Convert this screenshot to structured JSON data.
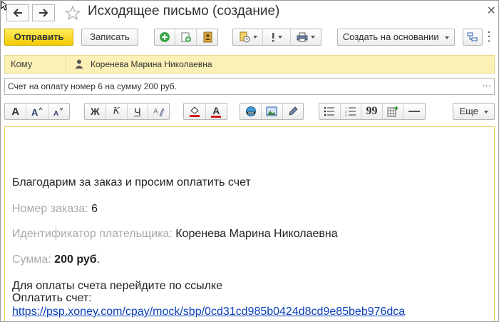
{
  "window": {
    "title": "Исходящее письмо (создание)",
    "close_glyph": "×",
    "more_glyph": "⋮"
  },
  "toolbar": {
    "send_label": "Отправить",
    "save_label": "Записать",
    "create_based_label": "Создать на основании"
  },
  "recipient": {
    "label": "Кому",
    "value": "Коренева Марина Николаевна"
  },
  "subject": {
    "value": "Счет на оплату номер 6 на сумму 200 руб.",
    "dots": "..."
  },
  "format_toolbar": {
    "bold": "А",
    "italic": "К",
    "underline": "Ч",
    "strike": "Ж",
    "font_color": "А",
    "quote": "99",
    "more_label": "Еще"
  },
  "message": {
    "greeting": "Благодарим за заказ и просим оплатить счет",
    "order_label": "Номер заказа:",
    "order_value": "6",
    "payer_label": "Идентификатор плательщика:",
    "payer_value": "Коренева Марина Николаевна",
    "sum_label": "Сумма:",
    "sum_value": "200 руб",
    "sum_dot": ".",
    "pay_hint": "Для оплаты счета перейдите по ссылке",
    "pay_label": "Оплатить счет:",
    "pay_link": "https://psp.xoney.com/cpay/mock/sbp/0cd31cd985b0424d8cd9e85beb976dca"
  },
  "colors": {
    "primary_button": "#f2c800",
    "recipient_bg": "#fbf0b6",
    "link": "#0a3fb8",
    "muted_label": "#aaaaaa"
  }
}
